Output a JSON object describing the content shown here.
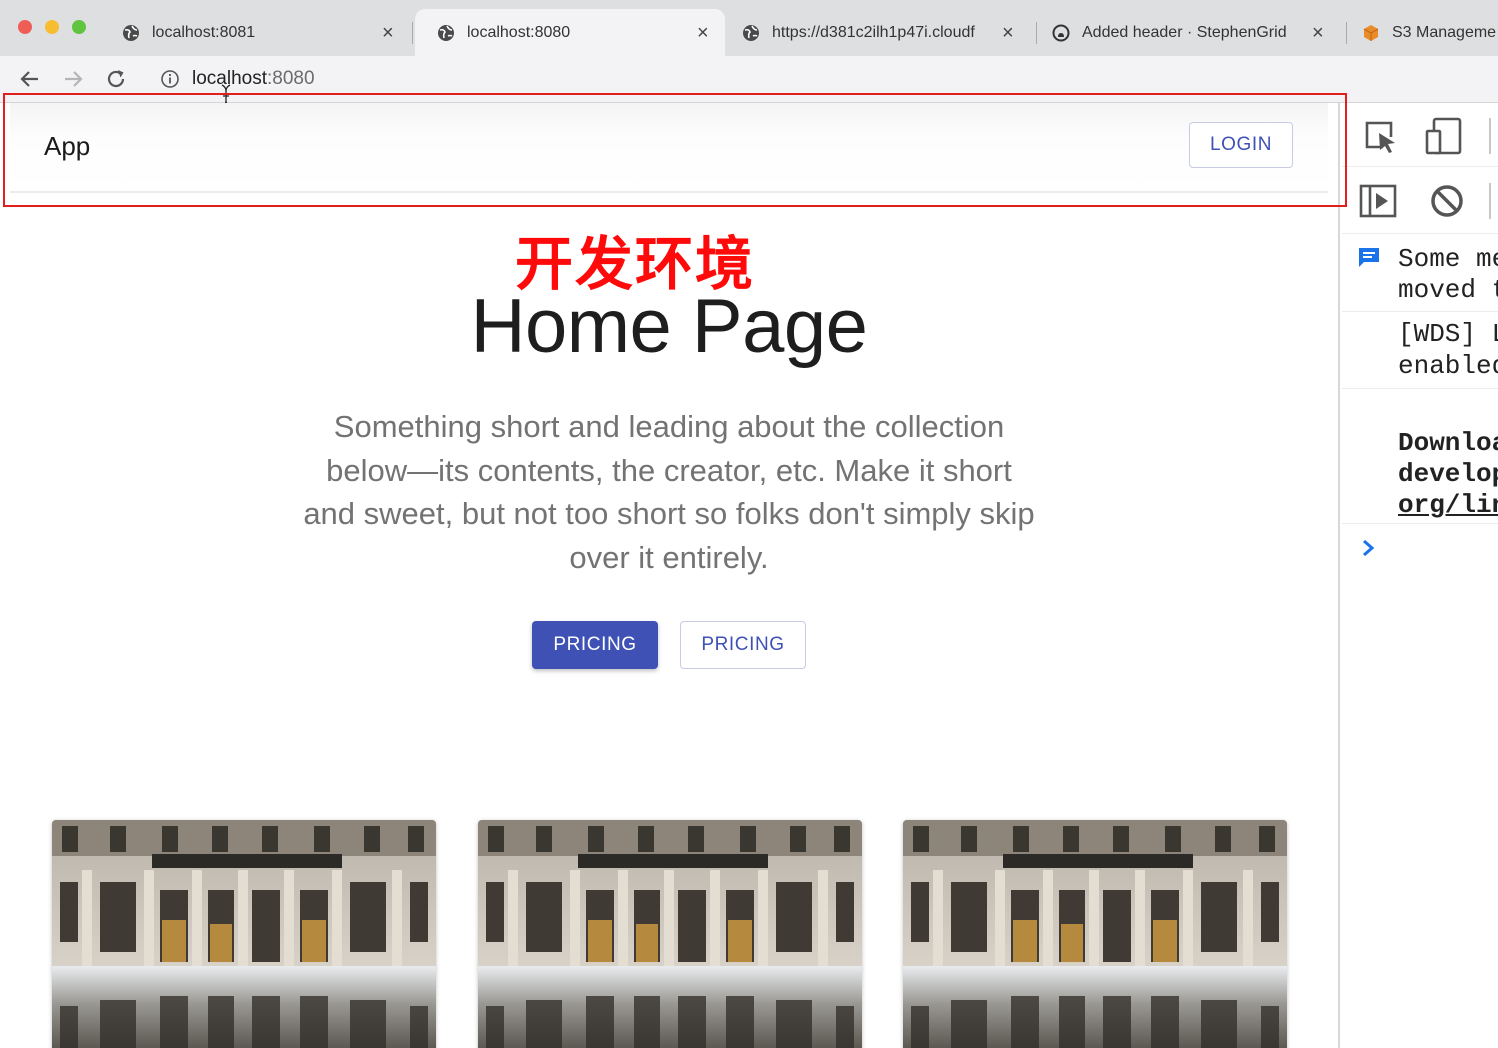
{
  "browser": {
    "tabs": [
      {
        "title": "localhost:8081",
        "icon": "globe-icon",
        "active": false
      },
      {
        "title": "localhost:8080",
        "icon": "globe-icon",
        "active": true
      },
      {
        "title": "https://d381c2ilh1p47i.cloudf",
        "icon": "globe-icon",
        "active": false
      },
      {
        "title": "Added header · StephenGrid",
        "icon": "github-icon",
        "active": false
      },
      {
        "title": "S3 Manageme",
        "icon": "aws-cube-icon",
        "active": false
      }
    ],
    "url_host": "localhost",
    "url_port": ":8080"
  },
  "app": {
    "brand": "App",
    "login_label": "LOGIN"
  },
  "annotation": {
    "label": "开发环境",
    "color": "#ff0a0a"
  },
  "hero": {
    "title": "Home Page",
    "description": "Something short and leading about the collection below—its contents, the creator, etc. Make it short and sweet, but not too short so folks don't simply skip over it entirely.",
    "primary_button": "PRICING",
    "secondary_button": "PRICING"
  },
  "cards": [
    {
      "image": "palace-facade-reflection"
    },
    {
      "image": "palace-facade-reflection"
    },
    {
      "image": "palace-facade-reflection"
    }
  ],
  "devtools": {
    "messages": [
      {
        "line1": "Some me",
        "line2": "moved t",
        "icon": "message-icon"
      },
      {
        "line1": "[WDS] L",
        "line2": "enabled"
      },
      {
        "line1": "Downloa",
        "line2": "develop",
        "line3": "org/lin"
      }
    ],
    "prompt": ">"
  },
  "colors": {
    "primary": "#3f51b5",
    "annotation_box": "#e0201e"
  }
}
